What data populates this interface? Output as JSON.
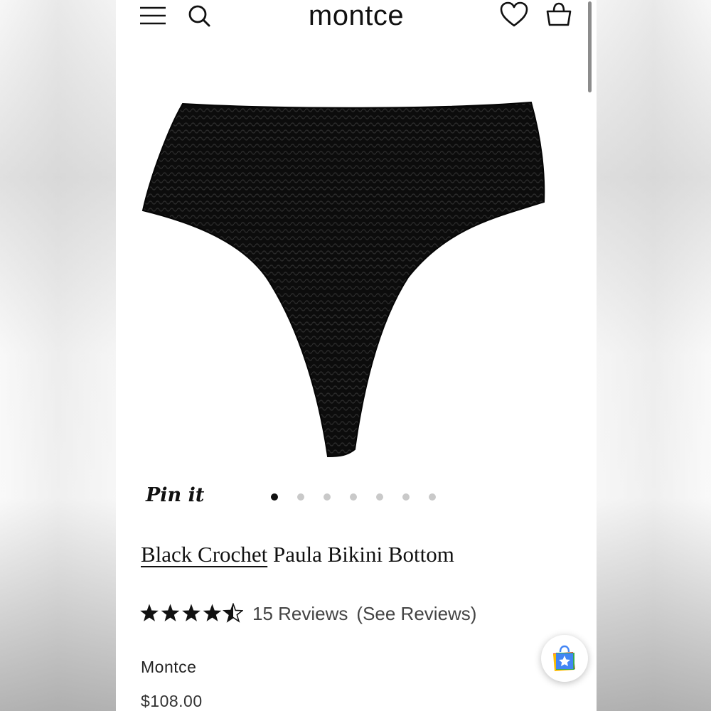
{
  "app": {
    "logo": "montce"
  },
  "header": {
    "menu_icon": "hamburger-menu-icon",
    "search_icon": "search-icon",
    "wishlist_icon": "heart-icon",
    "cart_icon": "basket-icon"
  },
  "gallery": {
    "pin_label": "Pin it",
    "image_count": 7,
    "active_index": 0
  },
  "product": {
    "title_linked": "Black Crochet",
    "title_rest": " Paula Bikini Bottom",
    "rating": 4.5,
    "rating_max": 5,
    "reviews_label": "15 Reviews",
    "see_reviews": "(See Reviews)",
    "vendor": "Montce",
    "price": "$108.00"
  },
  "fab": {
    "icon": "shopping-bag-star-icon"
  },
  "colors": {
    "text": "#111111",
    "muted": "#444444",
    "dot_inactive": "#c9c9c9"
  }
}
